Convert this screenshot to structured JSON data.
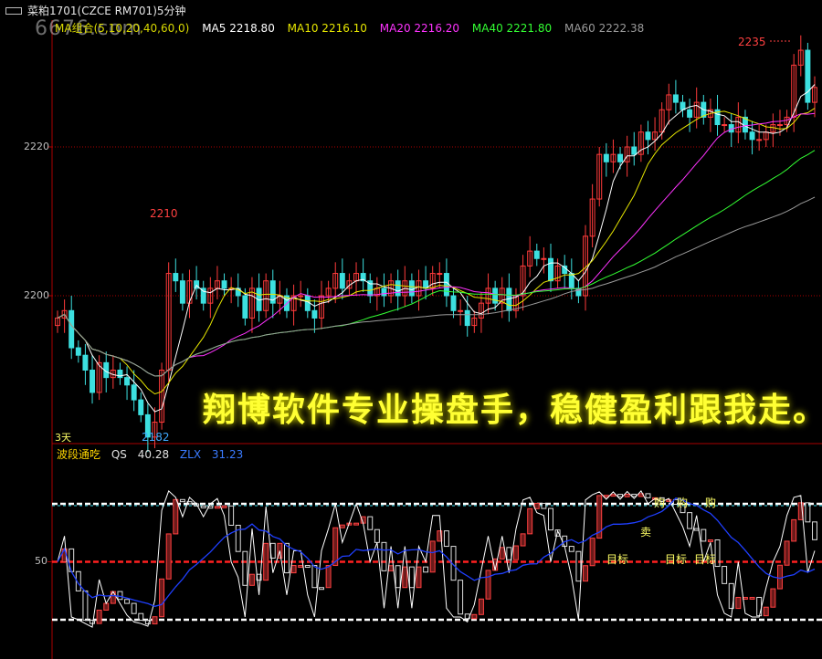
{
  "title": {
    "icon": "window-icon",
    "text": "菜粕1701(CZCE RM701)5分钟"
  },
  "watermark": "6676.com",
  "ma_legend": [
    {
      "text": "MA组合(5,10,20,40,60,0)",
      "color": "#d8d800"
    },
    {
      "text": "MA5 2218.80",
      "color": "#ffffff"
    },
    {
      "text": "MA10 2216.10",
      "color": "#e6e600"
    },
    {
      "text": "MA20 2216.20",
      "color": "#ff33ff"
    },
    {
      "text": "MA40 2221.80",
      "color": "#33ff33"
    },
    {
      "text": "MA60 2222.38",
      "color": "#9a9a9a"
    }
  ],
  "price_axis": {
    "labels": [
      "2220",
      "2200"
    ]
  },
  "annotations": {
    "high_left": "2210",
    "low": "2182",
    "high_right": "2235",
    "days": "3天"
  },
  "promo": "翔博软件专业操盘手，稳健盈利跟我走。",
  "indicator": {
    "name": "波段通吃",
    "qs_label": "QS",
    "qs_value": "40.28",
    "zlx_label": "ZLX",
    "zlx_value": "31.23",
    "level_label": "50",
    "signals": {
      "buy": [
        "购",
        "购",
        "购"
      ],
      "sell": "卖",
      "targets": [
        "目标",
        "目标",
        "目标"
      ]
    }
  },
  "chart_data": [
    {
      "type": "candlestick",
      "title": "菜粕1701(CZCE RM701)5分钟",
      "ylim": [
        2180,
        2240
      ],
      "series": [
        {
          "name": "MA5",
          "value": 2218.8
        },
        {
          "name": "MA10",
          "value": 2216.1
        },
        {
          "name": "MA20",
          "value": 2216.2
        },
        {
          "name": "MA40",
          "value": 2221.8
        },
        {
          "name": "MA60",
          "value": 2222.38
        }
      ],
      "close": [
        2197,
        2198,
        2193,
        2192,
        2190,
        2187,
        2191,
        2189,
        2190,
        2189,
        2188,
        2186,
        2184,
        2181,
        2183,
        2190,
        2203,
        2202,
        2199,
        2202,
        2201,
        2199,
        2201,
        2202,
        2201,
        2201,
        2200,
        2197,
        2201,
        2198,
        2202,
        2199,
        2200,
        2198,
        2200,
        2200,
        2198,
        2197,
        2200,
        2201,
        2203,
        2201,
        2202,
        2203,
        2202,
        2200,
        2201,
        2200,
        2202,
        2200,
        2202,
        2200,
        2202,
        2201,
        2203,
        2203,
        2200,
        2198,
        2198,
        2196,
        2197,
        2199,
        2201,
        2199,
        2201,
        2198,
        2200,
        2204,
        2206,
        2205,
        2205,
        2202,
        2204,
        2203,
        2201,
        2200,
        2208,
        2213,
        2219,
        2218,
        2219,
        2218,
        2220,
        2219,
        2222,
        2221,
        2222,
        2225,
        2227,
        2226,
        2225,
        2224,
        2226,
        2224,
        2225,
        2223,
        2223,
        2222,
        2224,
        2222,
        2221,
        2221,
        2222,
        2223,
        2223,
        2224,
        2231,
        2233,
        2226,
        2228
      ]
    },
    {
      "type": "line",
      "title": "波段通吃",
      "ylim": [
        0,
        100
      ],
      "series": [
        {
          "name": "QS",
          "value": 40.28
        },
        {
          "name": "ZLX",
          "value": 31.23
        }
      ],
      "levels": [
        80,
        50,
        20
      ]
    }
  ]
}
